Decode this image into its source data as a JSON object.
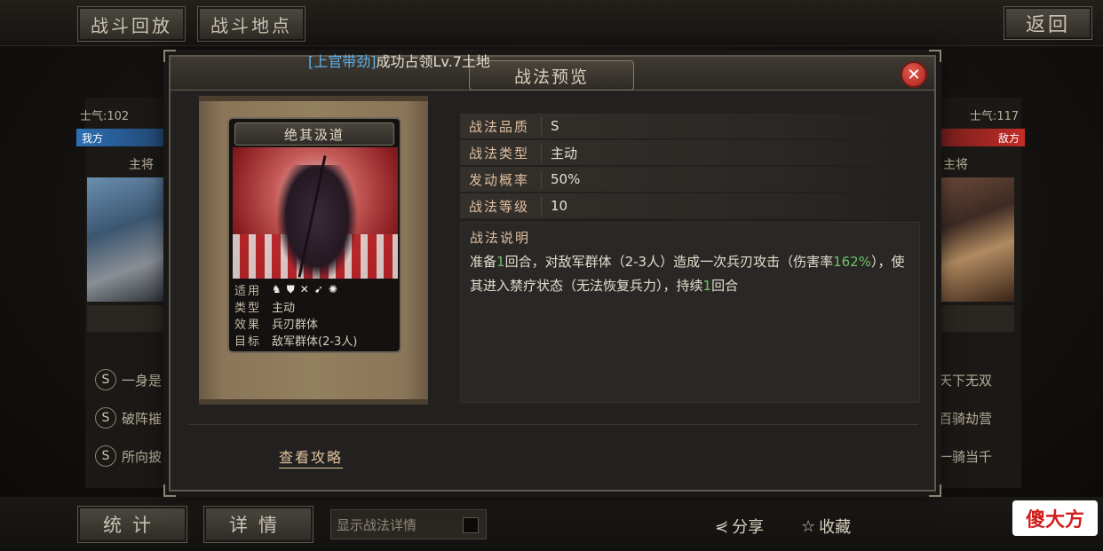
{
  "top_bar": {
    "replay_label": "战斗回放",
    "location_label": "战斗地点",
    "return_label": "返回"
  },
  "battle_log": {
    "name": "[上官带劲]",
    "message": "成功占领Lv.7土地"
  },
  "left_side": {
    "morale": "士气:102",
    "tag": "我方",
    "general_label": "主将",
    "skills": [
      "一身是",
      "破阵摧",
      "所向披"
    ]
  },
  "right_side": {
    "morale": "士气:117",
    "tag": "敌方",
    "general_label": "主将",
    "skills": [
      "天下无双",
      "百骑劫营",
      "一骑当千"
    ]
  },
  "modal": {
    "title": "战法预览",
    "close_icon": "close-icon",
    "card": {
      "name": "绝其汲道",
      "info": [
        {
          "key": "适用",
          "value": ""
        },
        {
          "key": "类型",
          "value": "主动"
        },
        {
          "key": "效果",
          "value": "兵刃群体"
        },
        {
          "key": "目标",
          "value": "敌军群体(2-3人)"
        }
      ],
      "unit_icons": [
        "cavalry-icon",
        "shield-icon",
        "archer-icon",
        "spear-icon",
        "siege-icon"
      ]
    },
    "properties": [
      {
        "key": "战法品质",
        "value": "S"
      },
      {
        "key": "战法类型",
        "value": "主动"
      },
      {
        "key": "发动概率",
        "value": "50%"
      },
      {
        "key": "战法等级",
        "value": "10"
      }
    ],
    "description": {
      "title": "战法说明",
      "part1": "准备",
      "hl1": "1",
      "part2": "回合，对敌军群体（2-3人）造成一次兵刃攻击（伤害率",
      "hl2": "162%",
      "part3": "），使其进入禁疗状态（无法恢复兵力），持续",
      "hl3": "1",
      "part4": "回合"
    },
    "guide_link": "查看攻略"
  },
  "bottom_bar": {
    "stats_label": "统计",
    "details_label": "详情",
    "toggle_label": "显示战法详情",
    "share_label": "分享",
    "favorite_label": "收藏"
  },
  "watermark": "傻大方",
  "colors": {
    "highlight_green": "#6fc268",
    "accent_gold": "#e1c39d",
    "close_red": "#c42a22",
    "ally_blue": "#2d6fb4",
    "enemy_red": "#c32c26"
  }
}
